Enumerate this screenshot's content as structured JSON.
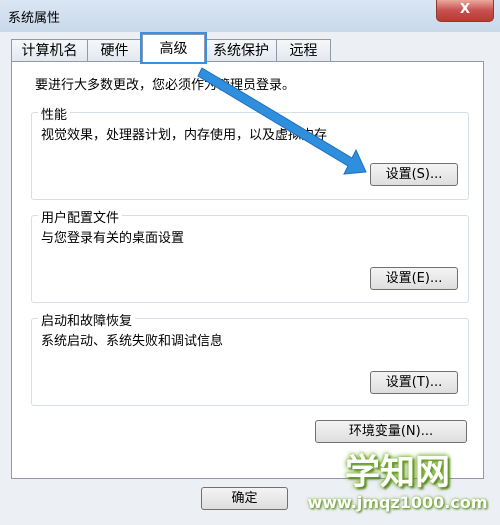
{
  "window": {
    "title": "系统属性",
    "close_label": "X"
  },
  "tabs": [
    {
      "label": "计算机名"
    },
    {
      "label": "硬件"
    },
    {
      "label": "高级",
      "active": true
    },
    {
      "label": "系统保护"
    },
    {
      "label": "远程"
    }
  ],
  "admin_note": "要进行大多数更改，您必须作为管理员登录。",
  "groups": {
    "performance": {
      "title": "性能",
      "description": "视觉效果，处理器计划，内存使用，以及虚拟内存",
      "button": "设置(S)..."
    },
    "user_profiles": {
      "title": "用户配置文件",
      "description": "与您登录有关的桌面设置",
      "button": "设置(E)..."
    },
    "startup_recovery": {
      "title": "启动和故障恢复",
      "description": "系统启动、系统失败和调试信息",
      "button": "设置(T)..."
    }
  },
  "env_button": "环境变量(N)...",
  "footer": {
    "ok_label": "确定"
  },
  "watermark": {
    "main": "学知网",
    "url": "www.jmqz1000.com"
  },
  "colors": {
    "highlight": "#3b8ee0",
    "arrow": "#2f8fdc"
  }
}
